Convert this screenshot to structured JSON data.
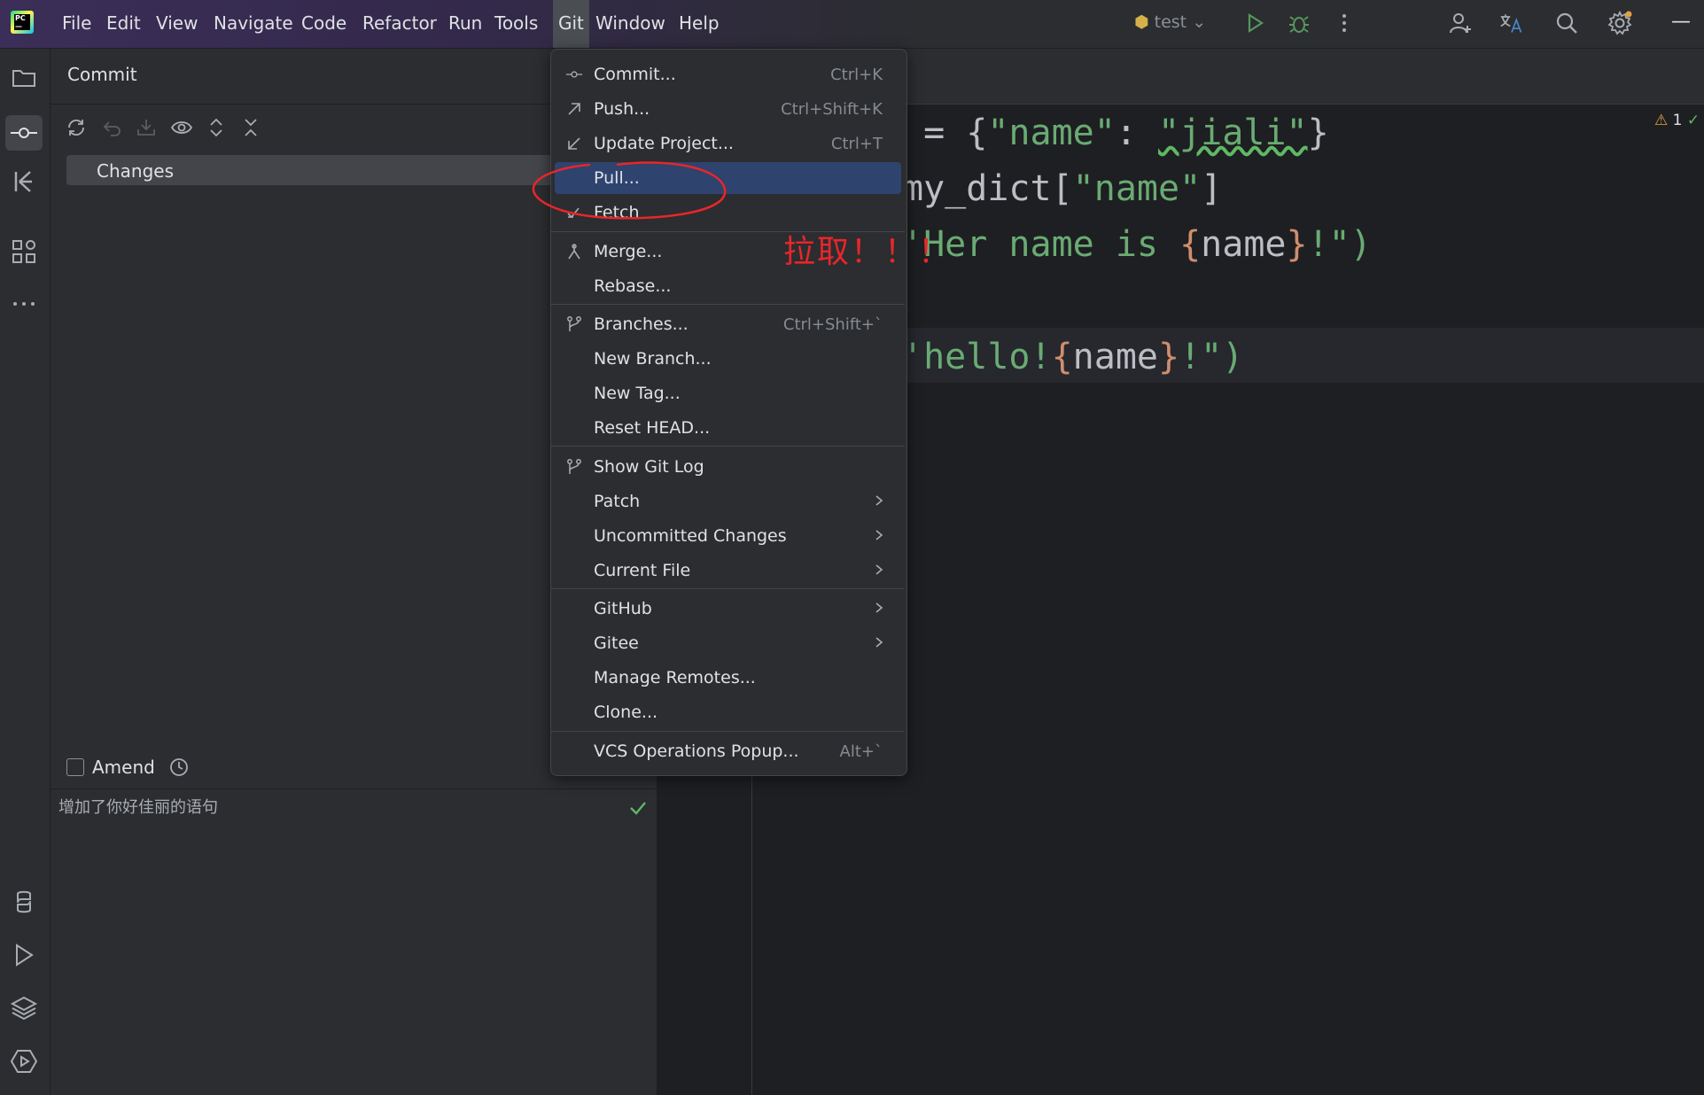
{
  "menubar": {
    "items": [
      "File",
      "Edit",
      "View",
      "Navigate",
      "Code",
      "Refactor",
      "Run",
      "Tools",
      "Git",
      "Window",
      "Help"
    ],
    "active": "Git",
    "run_config": "test"
  },
  "left_strip": {
    "icons": [
      "folder-icon",
      "commit-icon",
      "pull-requests-icon",
      "structure-icon",
      "more-icon",
      "python-console-icon",
      "run-icon",
      "layers-icon",
      "services-icon"
    ]
  },
  "commit_panel": {
    "title": "Commit",
    "changes_label": "Changes",
    "amend_label": "Amend",
    "message": "增加了你好佳丽的语句"
  },
  "editor": {
    "lines": [
      {
        "pre": " = {",
        "s1": "\"name\"",
        "mid": ": ",
        "s2": "\"jiali\"",
        "post": "}"
      },
      {
        "text": "my_dict[",
        "s1": "\"name\"",
        "post": "]"
      },
      {
        "s1": "'Her name is ",
        "b1": "{",
        "var": "name",
        "b2": "}",
        "s2": "!\")"
      },
      {
        "s1": "'hello!",
        "b1": "{",
        "var": "name",
        "b2": "}",
        "s2": "!\")"
      }
    ],
    "warning_count": "1"
  },
  "git_menu": {
    "items": [
      {
        "label": "Commit...",
        "shortcut": "Ctrl+K",
        "icon": "commit-icon"
      },
      {
        "label": "Push...",
        "shortcut": "Ctrl+Shift+K",
        "icon": "push-arrow-icon"
      },
      {
        "label": "Update Project...",
        "shortcut": "Ctrl+T",
        "icon": "update-arrow-icon"
      },
      {
        "label": "Pull...",
        "shortcut": "",
        "icon": ""
      },
      {
        "label": "Fetch",
        "shortcut": "",
        "icon": "fetch-icon"
      },
      {
        "label": "Merge...",
        "shortcut": "",
        "icon": "merge-icon"
      },
      {
        "label": "Rebase...",
        "shortcut": "",
        "icon": ""
      },
      {
        "label": "Branches...",
        "shortcut": "Ctrl+Shift+`",
        "icon": "branch-icon"
      },
      {
        "label": "New Branch...",
        "shortcut": "",
        "icon": ""
      },
      {
        "label": "New Tag...",
        "shortcut": "",
        "icon": ""
      },
      {
        "label": "Reset HEAD...",
        "shortcut": "",
        "icon": ""
      },
      {
        "label": "Show Git Log",
        "shortcut": "",
        "icon": "git-log-icon"
      },
      {
        "label": "Patch",
        "shortcut": "",
        "icon": ""
      },
      {
        "label": "Uncommitted Changes",
        "shortcut": "",
        "icon": ""
      },
      {
        "label": "Current File",
        "shortcut": "",
        "icon": ""
      },
      {
        "label": "GitHub",
        "shortcut": "",
        "icon": ""
      },
      {
        "label": "Gitee",
        "shortcut": "",
        "icon": ""
      },
      {
        "label": "Manage Remotes...",
        "shortcut": "",
        "icon": ""
      },
      {
        "label": "Clone...",
        "shortcut": "",
        "icon": ""
      },
      {
        "label": "VCS Operations Popup...",
        "shortcut": "Alt+`",
        "icon": ""
      }
    ],
    "highlighted": "Pull..."
  },
  "annotation": {
    "text": "拉取！！！",
    "color": "#e8262a"
  },
  "colors": {
    "accent_highlight": "#2e436e",
    "string": "#6aab73",
    "brace": "#cf8e6d"
  }
}
